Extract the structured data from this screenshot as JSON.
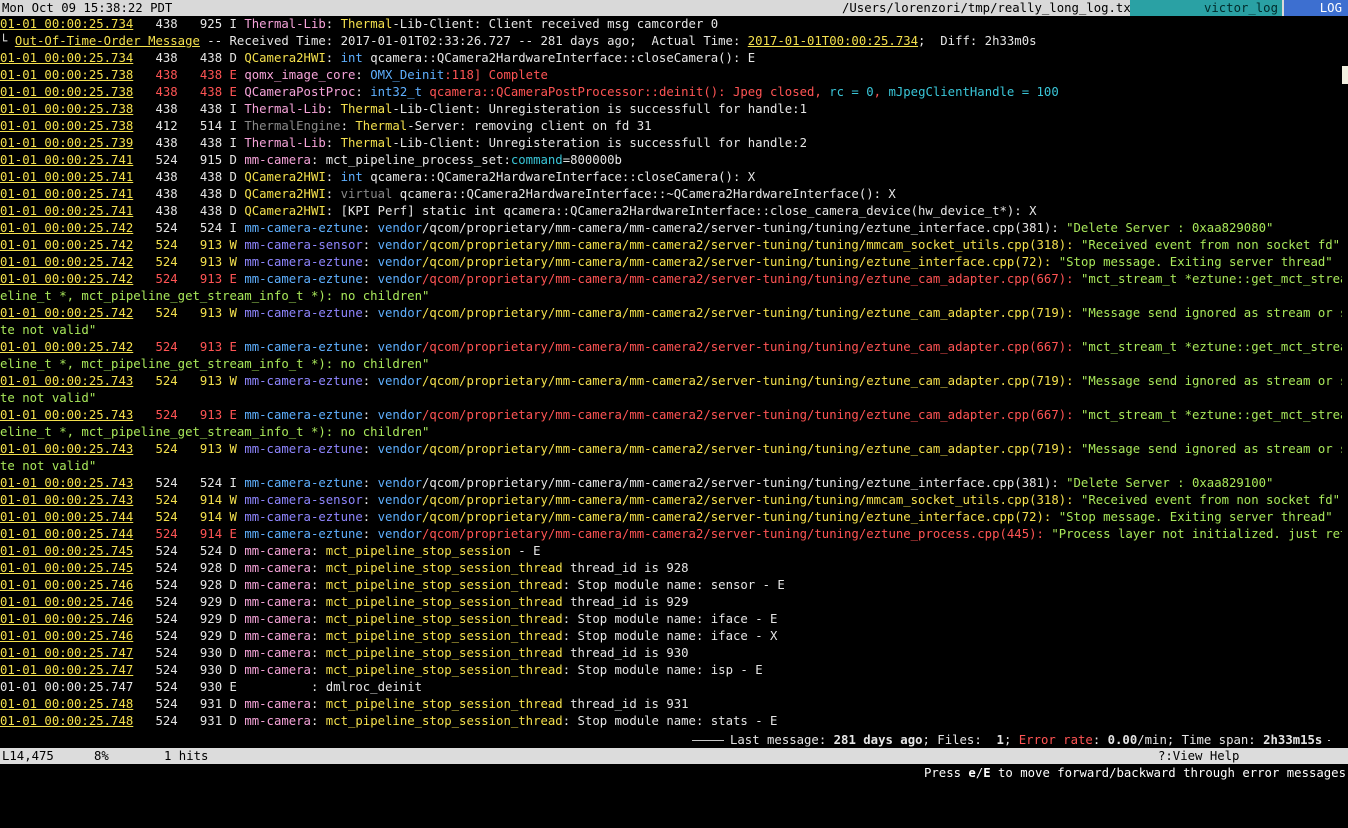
{
  "topbar": {
    "clock": "Mon Oct 09 15:38:22 PDT",
    "path": "/Users/lorenzori/tmp/really_long_log.txt",
    "user": "victor_log",
    "mode": "LOG"
  },
  "colors": {
    "timestamp": "#f4e04d",
    "error": "#ff5454",
    "tag_blue": "#5fb0ff",
    "tag_purple": "#8f86ff",
    "tag_pink": "#f6a3d9",
    "green_text": "#a9e85a",
    "bar_teal": "#2aa1a4",
    "bar_blue": "#3d6fd0"
  },
  "log_lines": [
    [
      {
        "t": "01-01 00:00:25.734",
        "c": "ts"
      },
      {
        "t": "   438   925 I "
      },
      {
        "t": "Thermal-Lib",
        "c": "tagc"
      },
      {
        "t": ": "
      },
      {
        "t": "Thermal",
        "c": "tagy"
      },
      {
        "t": "-Lib-Client: Client received msg camcorder 0"
      }
    ],
    [
      {
        "t": "└ "
      },
      {
        "t": "Out-Of-Time-Order Message",
        "c": "ts"
      },
      {
        "t": " -- Received Time: 2017-01-01T02:33:26.727 -- 281 days ago;  Actual Time: "
      },
      {
        "t": "2017-01-01T00:00:25.734",
        "c": "ts"
      },
      {
        "t": ";  Diff: 2h33m0s"
      }
    ],
    [
      {
        "t": "01-01 00:00:25.734",
        "c": "ts"
      },
      {
        "t": "   438   438 D "
      },
      {
        "t": "QCamera2HWI",
        "c": "tagy"
      },
      {
        "t": ": "
      },
      {
        "t": "int",
        "c": "tagb"
      },
      {
        "t": " qcamera::QCamera2HardwareInterface::closeCamera(): E"
      }
    ],
    [
      {
        "t": "01-01 00:00:25.738",
        "c": "ts"
      },
      {
        "t": "   438   438 E ",
        "c": "err"
      },
      {
        "t": "qomx_image_core",
        "c": "tagc"
      },
      {
        "t": ": "
      },
      {
        "t": "OMX_Deinit",
        "c": "tagb"
      },
      {
        "t": ":118] Complete",
        "c": "err"
      }
    ],
    [
      {
        "t": "01-01 00:00:25.738",
        "c": "ts"
      },
      {
        "t": "   438   438 E ",
        "c": "err"
      },
      {
        "t": "QCameraPostProc",
        "c": "tagc"
      },
      {
        "t": ": "
      },
      {
        "t": "int32_t",
        "c": "tagb"
      },
      {
        "t": " qcamera::QCameraPostProcessor::deinit(): Jpeg closed, ",
        "c": "err"
      },
      {
        "t": "rc = 0",
        "c": "tagt"
      },
      {
        "t": ", ",
        "c": "err"
      },
      {
        "t": "mJpegClientHandle = 100",
        "c": "tagt"
      }
    ],
    [
      {
        "t": "01-01 00:00:25.738",
        "c": "ts"
      },
      {
        "t": "   438   438 I "
      },
      {
        "t": "Thermal-Lib",
        "c": "tagc"
      },
      {
        "t": ": "
      },
      {
        "t": "Thermal",
        "c": "tagy"
      },
      {
        "t": "-Lib-Client: Unregisteration is successfull for handle:1"
      }
    ],
    [
      {
        "t": "01-01 00:00:25.738",
        "c": "ts"
      },
      {
        "t": "   412   514 I "
      },
      {
        "t": "ThermalEngine",
        "c": "tagg"
      },
      {
        "t": ": "
      },
      {
        "t": "Thermal",
        "c": "tagy"
      },
      {
        "t": "-Server: removing client on fd 31"
      }
    ],
    [
      {
        "t": "01-01 00:00:25.739",
        "c": "ts"
      },
      {
        "t": "   438   438 I "
      },
      {
        "t": "Thermal-Lib",
        "c": "tagc"
      },
      {
        "t": ": "
      },
      {
        "t": "Thermal",
        "c": "tagy"
      },
      {
        "t": "-Lib-Client: Unregisteration is successfull for handle:2"
      }
    ],
    [
      {
        "t": "01-01 00:00:25.741",
        "c": "ts"
      },
      {
        "t": "   524   915 D "
      },
      {
        "t": "mm-camera",
        "c": "tagc"
      },
      {
        "t": ": mct_pipeline_process_set:"
      },
      {
        "t": "command",
        "c": "tagt"
      },
      {
        "t": "=800000b"
      }
    ],
    [
      {
        "t": "01-01 00:00:25.741",
        "c": "ts"
      },
      {
        "t": "   438   438 D "
      },
      {
        "t": "QCamera2HWI",
        "c": "tagy"
      },
      {
        "t": ": "
      },
      {
        "t": "int",
        "c": "tagb"
      },
      {
        "t": " qcamera::QCamera2HardwareInterface::closeCamera(): X"
      }
    ],
    [
      {
        "t": "01-01 00:00:25.741",
        "c": "ts"
      },
      {
        "t": "   438   438 D "
      },
      {
        "t": "QCamera2HWI",
        "c": "tagy"
      },
      {
        "t": ": "
      },
      {
        "t": "virtual",
        "c": "tagg"
      },
      {
        "t": " qcamera::QCamera2HardwareInterface::~QCamera2HardwareInterface(): X"
      }
    ],
    [
      {
        "t": "01-01 00:00:25.741",
        "c": "ts"
      },
      {
        "t": "   438   438 D "
      },
      {
        "t": "QCamera2HWI",
        "c": "tagy"
      },
      {
        "t": ": [KPI Perf] static int qcamera::QCamera2HardwareInterface::close_camera_device(hw_device_t*): X"
      }
    ],
    [
      {
        "t": "01-01 00:00:25.742",
        "c": "ts"
      },
      {
        "t": "   524   524 I "
      },
      {
        "t": "mm-camera-eztune",
        "c": "tagb"
      },
      {
        "t": ": "
      },
      {
        "t": "vendor",
        "c": "tagb"
      },
      {
        "t": "/qcom/proprietary/mm-camera/mm-camera2/server-tuning/tuning/eztune_interface.cpp(381): "
      },
      {
        "t": "\"Delete Server : 0xaa829080\"",
        "c": "grn"
      }
    ],
    [
      {
        "t": "01-01 00:00:25.742",
        "c": "ts"
      },
      {
        "t": "   524   913 W ",
        "c": "tagy"
      },
      {
        "t": "mm-camera-sensor",
        "c": "tagm"
      },
      {
        "t": ": "
      },
      {
        "t": "vendor",
        "c": "tagb"
      },
      {
        "t": "/qcom/proprietary/mm-camera/mm-camera2/server-tuning/tuning/mmcam_socket_utils.cpp(318): ",
        "c": "tagy"
      },
      {
        "t": "\"Received event from non socket fd\"",
        "c": "grn"
      }
    ],
    [
      {
        "t": "01-01 00:00:25.742",
        "c": "ts"
      },
      {
        "t": "   524   913 W ",
        "c": "tagy"
      },
      {
        "t": "mm-camera-eztune",
        "c": "tagm"
      },
      {
        "t": ": "
      },
      {
        "t": "vendor",
        "c": "tagb"
      },
      {
        "t": "/qcom/proprietary/mm-camera/mm-camera2/server-tuning/tuning/eztune_interface.cpp(72): ",
        "c": "tagy"
      },
      {
        "t": "\"Stop message. Exiting server thread\"",
        "c": "grn"
      }
    ],
    [
      {
        "t": "01-01 00:00:25.742",
        "c": "ts"
      },
      {
        "t": "   524   913 E ",
        "c": "err"
      },
      {
        "t": "mm-camera-eztune",
        "c": "tagb"
      },
      {
        "t": ": "
      },
      {
        "t": "vendor",
        "c": "tagb"
      },
      {
        "t": "/qcom/proprietary/mm-camera/mm-camera2/server-tuning/tuning/eztune_cam_adapter.cpp(667): ",
        "c": "err"
      },
      {
        "t": "\"mct_stream_t *eztune::get_mct_stream(mct_pip",
        "c": "grn"
      }
    ],
    [
      {
        "t": "eline_t *, mct_pipeline_get_stream_info_t *): no children\"",
        "c": "grn"
      }
    ],
    [
      {
        "t": "01-01 00:00:25.742",
        "c": "ts"
      },
      {
        "t": "   524   913 W ",
        "c": "tagy"
      },
      {
        "t": "mm-camera-eztune",
        "c": "tagm"
      },
      {
        "t": ": "
      },
      {
        "t": "vendor",
        "c": "tagb"
      },
      {
        "t": "/qcom/proprietary/mm-camera/mm-camera2/server-tuning/tuning/eztune_cam_adapter.cpp(719): ",
        "c": "tagy"
      },
      {
        "t": "\"Message send ignored as stream or stream sta",
        "c": "grn"
      }
    ],
    [
      {
        "t": "te not valid\"",
        "c": "grn"
      }
    ],
    [
      {
        "t": "01-01 00:00:25.742",
        "c": "ts"
      },
      {
        "t": "   524   913 E ",
        "c": "err"
      },
      {
        "t": "mm-camera-eztune",
        "c": "tagb"
      },
      {
        "t": ": "
      },
      {
        "t": "vendor",
        "c": "tagb"
      },
      {
        "t": "/qcom/proprietary/mm-camera/mm-camera2/server-tuning/tuning/eztune_cam_adapter.cpp(667): ",
        "c": "err"
      },
      {
        "t": "\"mct_stream_t *eztune::get_mct_stream(mct_pip",
        "c": "grn"
      }
    ],
    [
      {
        "t": "eline_t *, mct_pipeline_get_stream_info_t *): no children\"",
        "c": "grn"
      }
    ],
    [
      {
        "t": "01-01 00:00:25.743",
        "c": "ts"
      },
      {
        "t": "   524   913 W ",
        "c": "tagy"
      },
      {
        "t": "mm-camera-eztune",
        "c": "tagm"
      },
      {
        "t": ": "
      },
      {
        "t": "vendor",
        "c": "tagb"
      },
      {
        "t": "/qcom/proprietary/mm-camera/mm-camera2/server-tuning/tuning/eztune_cam_adapter.cpp(719): ",
        "c": "tagy"
      },
      {
        "t": "\"Message send ignored as stream or stream sta",
        "c": "grn"
      }
    ],
    [
      {
        "t": "te not valid\"",
        "c": "grn"
      }
    ],
    [
      {
        "t": "01-01 00:00:25.743",
        "c": "ts"
      },
      {
        "t": "   524   913 E ",
        "c": "err"
      },
      {
        "t": "mm-camera-eztune",
        "c": "tagb"
      },
      {
        "t": ": "
      },
      {
        "t": "vendor",
        "c": "tagb"
      },
      {
        "t": "/qcom/proprietary/mm-camera/mm-camera2/server-tuning/tuning/eztune_cam_adapter.cpp(667): ",
        "c": "err"
      },
      {
        "t": "\"mct_stream_t *eztune::get_mct_stream(mct_pip",
        "c": "grn"
      }
    ],
    [
      {
        "t": "eline_t *, mct_pipeline_get_stream_info_t *): no children\"",
        "c": "grn"
      }
    ],
    [
      {
        "t": "01-01 00:00:25.743",
        "c": "ts"
      },
      {
        "t": "   524   913 W ",
        "c": "tagy"
      },
      {
        "t": "mm-camera-eztune",
        "c": "tagm"
      },
      {
        "t": ": "
      },
      {
        "t": "vendor",
        "c": "tagb"
      },
      {
        "t": "/qcom/proprietary/mm-camera/mm-camera2/server-tuning/tuning/eztune_cam_adapter.cpp(719): ",
        "c": "tagy"
      },
      {
        "t": "\"Message send ignored as stream or stream sta",
        "c": "grn"
      }
    ],
    [
      {
        "t": "te not valid\"",
        "c": "grn"
      }
    ],
    [
      {
        "t": "01-01 00:00:25.743",
        "c": "ts"
      },
      {
        "t": "   524   524 I "
      },
      {
        "t": "mm-camera-eztune",
        "c": "tagb"
      },
      {
        "t": ": "
      },
      {
        "t": "vendor",
        "c": "tagb"
      },
      {
        "t": "/qcom/proprietary/mm-camera/mm-camera2/server-tuning/tuning/eztune_interface.cpp(381): "
      },
      {
        "t": "\"Delete Server : 0xaa829100\"",
        "c": "grn"
      }
    ],
    [
      {
        "t": "01-01 00:00:25.743",
        "c": "ts"
      },
      {
        "t": "   524   914 W ",
        "c": "tagy"
      },
      {
        "t": "mm-camera-sensor",
        "c": "tagm"
      },
      {
        "t": ": "
      },
      {
        "t": "vendor",
        "c": "tagb"
      },
      {
        "t": "/qcom/proprietary/mm-camera/mm-camera2/server-tuning/tuning/mmcam_socket_utils.cpp(318): ",
        "c": "tagy"
      },
      {
        "t": "\"Received event from non socket fd\"",
        "c": "grn"
      }
    ],
    [
      {
        "t": "01-01 00:00:25.744",
        "c": "ts"
      },
      {
        "t": "   524   914 W ",
        "c": "tagy"
      },
      {
        "t": "mm-camera-eztune",
        "c": "tagm"
      },
      {
        "t": ": "
      },
      {
        "t": "vendor",
        "c": "tagb"
      },
      {
        "t": "/qcom/proprietary/mm-camera/mm-camera2/server-tuning/tuning/eztune_interface.cpp(72): ",
        "c": "tagy"
      },
      {
        "t": "\"Stop message. Exiting server thread\"",
        "c": "grn"
      }
    ],
    [
      {
        "t": "01-01 00:00:25.744",
        "c": "ts"
      },
      {
        "t": "   524   914 E ",
        "c": "err"
      },
      {
        "t": "mm-camera-eztune",
        "c": "tagb"
      },
      {
        "t": ": "
      },
      {
        "t": "vendor",
        "c": "tagb"
      },
      {
        "t": "/qcom/proprietary/mm-camera/mm-camera2/server-tuning/tuning/eztune_process.cpp(445): ",
        "c": "err"
      },
      {
        "t": "\"Process layer not initialized. just return\"",
        "c": "grn"
      }
    ],
    [
      {
        "t": "01-01 00:00:25.745",
        "c": "ts"
      },
      {
        "t": "   524   524 D "
      },
      {
        "t": "mm-camera",
        "c": "tagc"
      },
      {
        "t": ": "
      },
      {
        "t": "mct_pipeline_stop_session",
        "c": "tagy"
      },
      {
        "t": " - E"
      }
    ],
    [
      {
        "t": "01-01 00:00:25.745",
        "c": "ts"
      },
      {
        "t": "   524   928 D "
      },
      {
        "t": "mm-camera",
        "c": "tagc"
      },
      {
        "t": ": "
      },
      {
        "t": "mct_pipeline_stop_session_thread",
        "c": "tagy"
      },
      {
        "t": " thread_id is 928"
      }
    ],
    [
      {
        "t": "01-01 00:00:25.746",
        "c": "ts"
      },
      {
        "t": "   524   928 D "
      },
      {
        "t": "mm-camera",
        "c": "tagc"
      },
      {
        "t": ": "
      },
      {
        "t": "mct_pipeline_stop_session_thread",
        "c": "tagy"
      },
      {
        "t": ": Stop module name: sensor - E"
      }
    ],
    [
      {
        "t": "01-01 00:00:25.746",
        "c": "ts"
      },
      {
        "t": "   524   929 D "
      },
      {
        "t": "mm-camera",
        "c": "tagc"
      },
      {
        "t": ": "
      },
      {
        "t": "mct_pipeline_stop_session_thread",
        "c": "tagy"
      },
      {
        "t": " thread_id is 929"
      }
    ],
    [
      {
        "t": "01-01 00:00:25.746",
        "c": "ts"
      },
      {
        "t": "   524   929 D "
      },
      {
        "t": "mm-camera",
        "c": "tagc"
      },
      {
        "t": ": "
      },
      {
        "t": "mct_pipeline_stop_session_thread",
        "c": "tagy"
      },
      {
        "t": ": Stop module name: iface - E"
      }
    ],
    [
      {
        "t": "01-01 00:00:25.746",
        "c": "ts"
      },
      {
        "t": "   524   929 D "
      },
      {
        "t": "mm-camera",
        "c": "tagc"
      },
      {
        "t": ": "
      },
      {
        "t": "mct_pipeline_stop_session_thread",
        "c": "tagy"
      },
      {
        "t": ": Stop module name: iface - X"
      }
    ],
    [
      {
        "t": "01-01 00:00:25.747",
        "c": "ts"
      },
      {
        "t": "   524   930 D "
      },
      {
        "t": "mm-camera",
        "c": "tagc"
      },
      {
        "t": ": "
      },
      {
        "t": "mct_pipeline_stop_session_thread",
        "c": "tagy"
      },
      {
        "t": " thread_id is 930"
      }
    ],
    [
      {
        "t": "01-01 00:00:25.747",
        "c": "ts"
      },
      {
        "t": "   524   930 D "
      },
      {
        "t": "mm-camera",
        "c": "tagc"
      },
      {
        "t": ": "
      },
      {
        "t": "mct_pipeline_stop_session_thread",
        "c": "tagy"
      },
      {
        "t": ": Stop module name: isp - E"
      }
    ],
    [
      {
        "t": "01-01 00:00:25.747",
        "c": "ts plain"
      },
      {
        "t": "   524   930 E          : dmlroc_deinit"
      }
    ],
    [
      {
        "t": "01-01 00:00:25.748",
        "c": "ts"
      },
      {
        "t": "   524   931 D "
      },
      {
        "t": "mm-camera",
        "c": "tagc"
      },
      {
        "t": ": "
      },
      {
        "t": "mct_pipeline_stop_session_thread",
        "c": "tagy"
      },
      {
        "t": " thread_id is 931"
      }
    ],
    [
      {
        "t": "01-01 00:00:25.748",
        "c": "ts"
      },
      {
        "t": "   524   931 D "
      },
      {
        "t": "mm-camera",
        "c": "tagc"
      },
      {
        "t": ": "
      },
      {
        "t": "mct_pipeline_stop_session_thread",
        "c": "tagy"
      },
      {
        "t": ": Stop module name: stats - E"
      }
    ]
  ],
  "summary": {
    "last_label": "Last message: ",
    "last_value": "281 days ago",
    "files_label": "; Files:  ",
    "files_value": "1",
    "sep": "; ",
    "error_label": "Error rate",
    "error_colon": ": ",
    "error_value": "0.00",
    "error_unit": "/min; Time span: ",
    "span_value": "2h33m15s"
  },
  "status": {
    "line": "L14,475",
    "percent": "8%",
    "hits": "1 hits",
    "help": "?:View Help"
  },
  "hint": {
    "pre": "Press ",
    "e": "e",
    "slash": "/",
    "E": "E",
    "post": " to move forward/backward through error messages"
  }
}
